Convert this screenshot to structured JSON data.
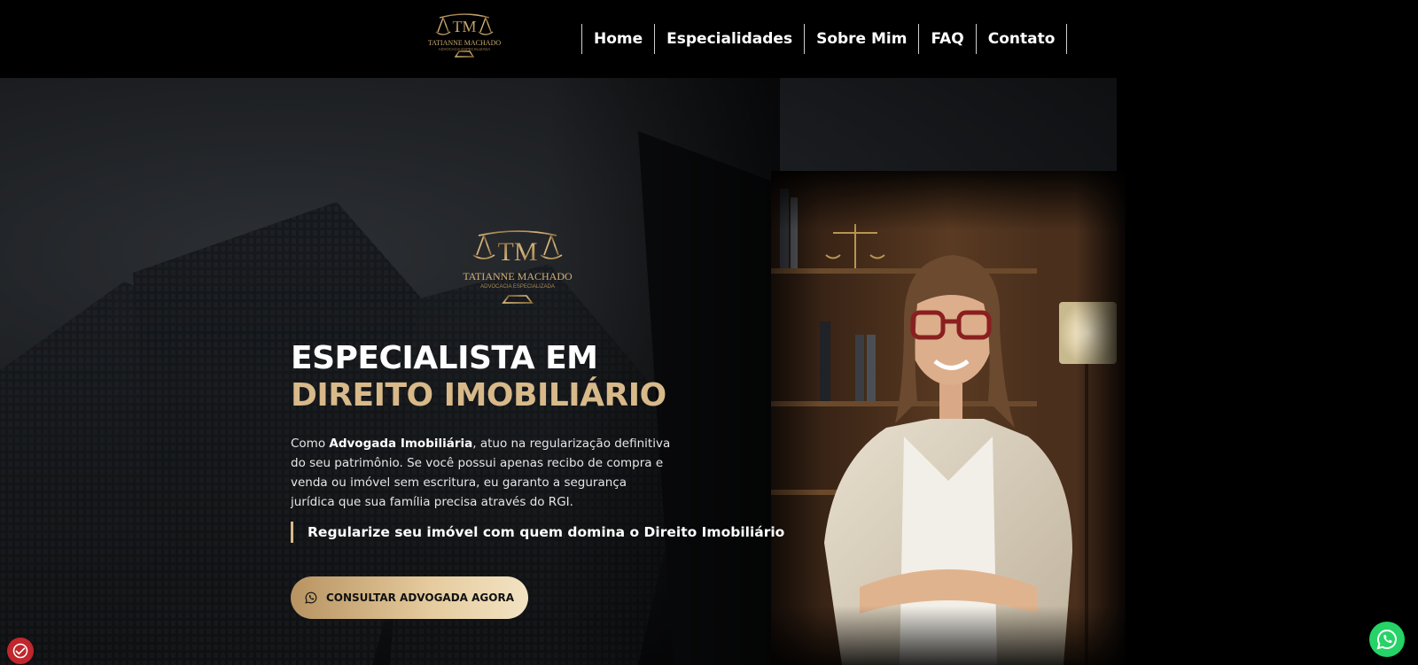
{
  "brand": {
    "name": "TATIANNE MACHADO",
    "subtitle": "ADVOCACIA ESPECIALIZADA",
    "monogram": "TM",
    "logo_icon": "scales-of-justice-icon"
  },
  "nav": {
    "items": [
      {
        "label": "Home"
      },
      {
        "label": "Especialidades"
      },
      {
        "label": "Sobre Mim"
      },
      {
        "label": "FAQ"
      },
      {
        "label": "Contato"
      }
    ]
  },
  "hero": {
    "title_line1": "ESPECIALISTA EM",
    "title_line2": "DIREITO IMOBILIÁRIO",
    "desc_intro": "Como ",
    "desc_bold": "Advogada Imobiliária",
    "desc_rest": ", atuo na regularização definitiva do seu patrimônio. Se você possui apenas recibo de compra e venda ou imóvel sem escritura, eu garanto a segurança jurídica que sua família precisa através do RGI.",
    "tagline": "Regularize seu imóvel com quem domina o Direito Imobiliário",
    "cta_label": "CONSULTAR ADVOGADA AGORA",
    "cta_icon": "whatsapp-icon"
  },
  "floating": {
    "whatsapp_icon": "whatsapp-icon",
    "accessibility_icon": "accessibility-icon"
  },
  "colors": {
    "accent_gold": "#d8b98a",
    "whatsapp_green": "#25d366",
    "accessibility_red": "#c0272d"
  }
}
